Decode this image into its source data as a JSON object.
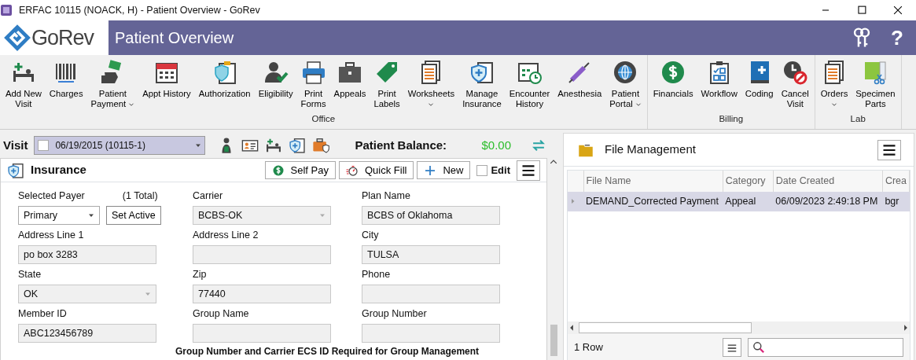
{
  "window": {
    "title": "ERFAC 10115 (NOACK, H) - Patient Overview - GoRev"
  },
  "header": {
    "logo": "GoRev",
    "title": "Patient Overview",
    "help": "?"
  },
  "toolbar": [
    {
      "group": "Office",
      "items": [
        {
          "label": "Add New\nVisit",
          "dropdown": false
        },
        {
          "label": "Charges",
          "dropdown": false
        },
        {
          "label": "Patient\nPayment",
          "dropdown": true
        },
        {
          "label": "Appt History",
          "dropdown": false
        },
        {
          "label": "Authorization",
          "dropdown": false
        },
        {
          "label": "Eligibility",
          "dropdown": false
        },
        {
          "label": "Print\nForms",
          "dropdown": false
        },
        {
          "label": "Appeals",
          "dropdown": false
        },
        {
          "label": "Print\nLabels",
          "dropdown": false
        },
        {
          "label": "Worksheets",
          "dropdown": true
        },
        {
          "label": "Manage\nInsurance",
          "dropdown": false
        },
        {
          "label": "Encounter\nHistory",
          "dropdown": false
        },
        {
          "label": "Anesthesia",
          "dropdown": false
        },
        {
          "label": "Patient\nPortal",
          "dropdown": true
        }
      ]
    },
    {
      "group": "Billing",
      "items": [
        {
          "label": "Financials",
          "dropdown": false
        },
        {
          "label": "Workflow",
          "dropdown": false
        },
        {
          "label": "Coding",
          "dropdown": false
        },
        {
          "label": "Cancel\nVisit",
          "dropdown": false
        }
      ]
    },
    {
      "group": "Lab",
      "items": [
        {
          "label": "Orders",
          "dropdown": true
        },
        {
          "label": "Specimen\nParts",
          "dropdown": false
        }
      ]
    }
  ],
  "visit": {
    "label": "Visit",
    "value": "06/19/2015 (10115-1)",
    "checked": false,
    "balance_label": "Patient Balance:",
    "balance": "$0.00"
  },
  "insurance": {
    "title": "Insurance",
    "buttons": [
      {
        "kind": "selfpay",
        "label": "Self Pay"
      },
      {
        "kind": "quickfill",
        "label": "Quick Fill"
      },
      {
        "kind": "new",
        "label": "New"
      }
    ],
    "edit": {
      "label": "Edit",
      "checked": false
    },
    "fields": [
      {
        "label": "Selected Payer",
        "note": "(1 Total)",
        "value": "Primary",
        "kind": "select",
        "disabled": false,
        "action": "Set Active"
      },
      {
        "label": "Carrier",
        "value": "BCBS-OK",
        "kind": "select",
        "disabled": true
      },
      {
        "label": "Plan Name",
        "value": "BCBS of Oklahoma",
        "kind": "input",
        "disabled": true
      },
      {
        "label": "Address Line 1",
        "value": "po box 3283",
        "kind": "input",
        "disabled": true
      },
      {
        "label": "Address Line 2",
        "kind": "input",
        "disabled": true
      },
      {
        "label": "City",
        "value": "TULSA",
        "kind": "input",
        "disabled": true
      },
      {
        "label": "State",
        "value": "OK",
        "kind": "select",
        "disabled": true
      },
      {
        "label": "Zip",
        "value": "77440",
        "kind": "input",
        "disabled": true
      },
      {
        "label": "Phone",
        "kind": "input",
        "disabled": true
      },
      {
        "label": "Member ID",
        "value": "ABC123456789",
        "kind": "input",
        "disabled": true
      },
      {
        "label": "Group Name",
        "kind": "input",
        "disabled": true
      },
      {
        "label": "Group Number",
        "kind": "input",
        "disabled": true
      }
    ],
    "note": "Group Number and Carrier ECS ID Required for Group Management"
  },
  "files": {
    "title": "File Management",
    "columns": [
      "File Name",
      "Category",
      "Date Created",
      "Crea"
    ],
    "rows": [
      {
        "cells": [
          "DEMAND_Corrected Payment",
          "Appeal",
          "06/09/2023 2:49:18 PM",
          "bgr"
        ],
        "selected": true
      }
    ],
    "count": "1 Row"
  }
}
